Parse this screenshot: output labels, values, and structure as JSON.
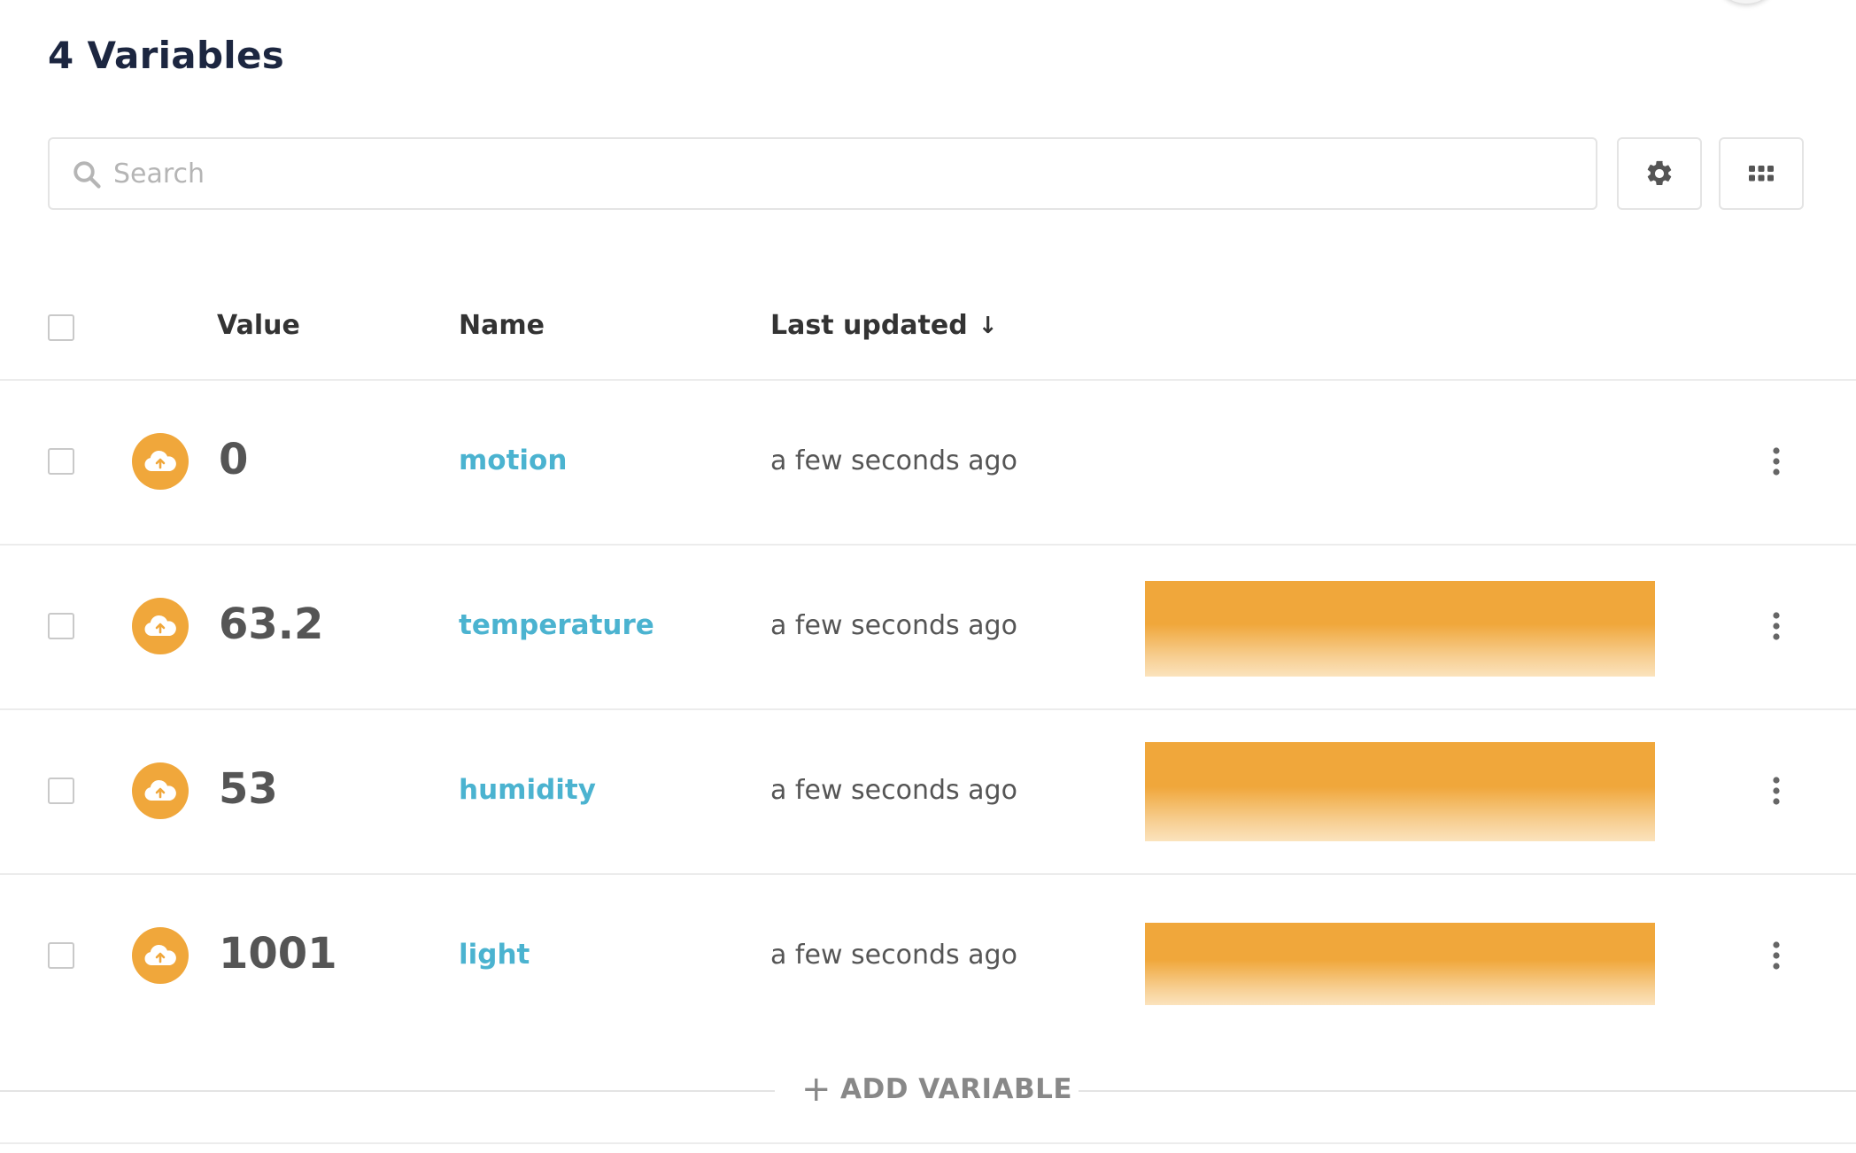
{
  "header": {
    "title": "4 Variables"
  },
  "search": {
    "placeholder": "Search",
    "value": ""
  },
  "table": {
    "columns": {
      "value": "Value",
      "name": "Name",
      "last_updated": "Last updated",
      "sort_indicator": "↓"
    },
    "rows": [
      {
        "value": "0",
        "name": "motion",
        "last_updated": "a few seconds ago",
        "has_sparkline": false
      },
      {
        "value": "63.2",
        "name": "temperature",
        "last_updated": "a few seconds ago",
        "has_sparkline": true
      },
      {
        "value": "53",
        "name": "humidity",
        "last_updated": "a few seconds ago",
        "has_sparkline": true
      },
      {
        "value": "1001",
        "name": "light",
        "last_updated": "a few seconds ago",
        "has_sparkline": true
      }
    ]
  },
  "actions": {
    "add_variable_plus": "+",
    "add_variable": "ADD VARIABLE"
  },
  "colors": {
    "accent": "#f0a73b",
    "link": "#4bb3d0",
    "title": "#1c2640"
  },
  "icons": {
    "search": "search-icon",
    "settings": "gear-icon",
    "view": "grid-icon",
    "row_source": "cloud-upload-icon",
    "row_menu": "kebab-menu-icon"
  }
}
